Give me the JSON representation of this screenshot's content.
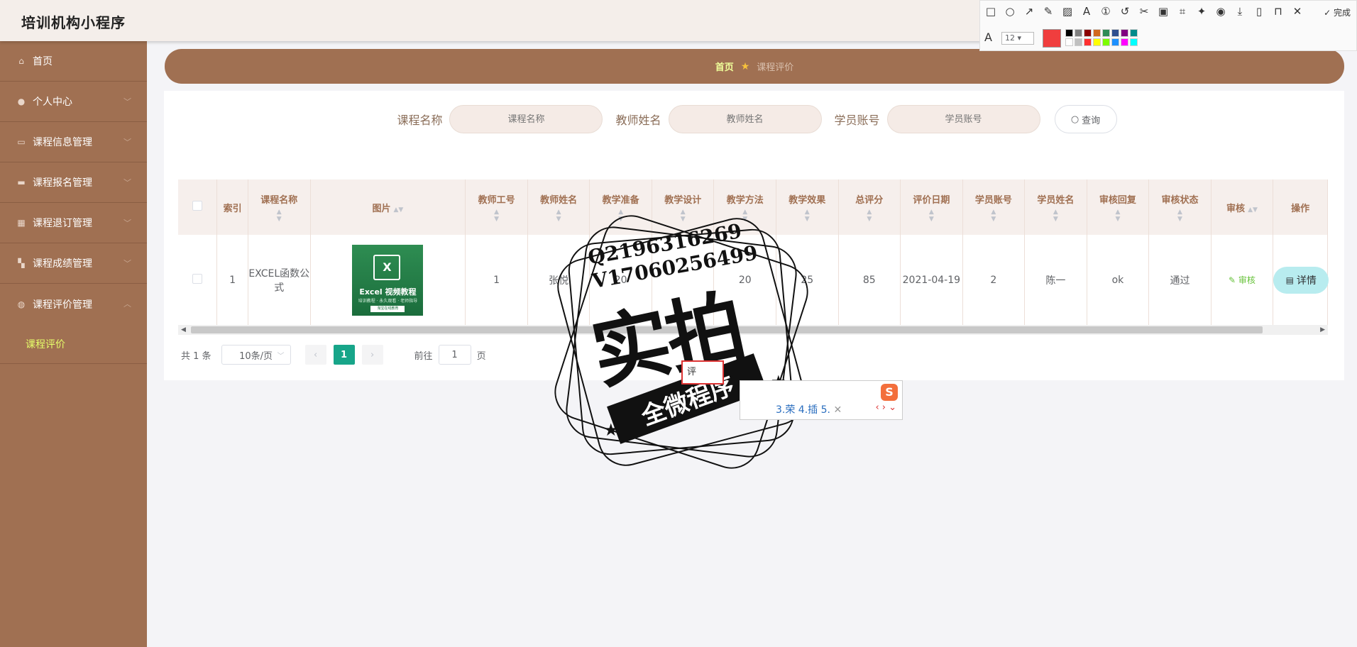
{
  "header": {
    "app_title": "培训机构小程序",
    "right_text": "…"
  },
  "sidebar": {
    "items": [
      {
        "label": "首页",
        "icon": "home-icon"
      },
      {
        "label": "个人中心",
        "icon": "user-icon"
      },
      {
        "label": "课程信息管理",
        "icon": "book-icon"
      },
      {
        "label": "课程报名管理",
        "icon": "form-icon"
      },
      {
        "label": "课程退订管理",
        "icon": "grid-icon"
      },
      {
        "label": "课程成绩管理",
        "icon": "apps-icon"
      },
      {
        "label": "课程评价管理",
        "icon": "circle-icon"
      }
    ],
    "submenu": [
      "课程评价"
    ]
  },
  "breadcrumb": {
    "home": "首页",
    "current": "课程评价"
  },
  "search": {
    "fields": [
      {
        "label": "课程名称",
        "placeholder": "课程名称"
      },
      {
        "label": "教师姓名",
        "placeholder": "教师姓名"
      },
      {
        "label": "学员账号",
        "placeholder": "学员账号"
      }
    ],
    "button": "查询"
  },
  "table": {
    "headers": [
      "索引",
      "课程名称",
      "图片",
      "教师工号",
      "教师姓名",
      "教学准备",
      "教学设计",
      "教学方法",
      "教学效果",
      "总评分",
      "评价日期",
      "学员账号",
      "学员姓名",
      "审核回复",
      "审核状态",
      "审核",
      "操作"
    ],
    "rows": [
      {
        "index": "1",
        "course_name": "EXCEL函数公式",
        "image_text": "Excel 视频教程",
        "image_sub": "培训教程 · 永久观看 · 老师指导",
        "image_tag": "淘宝在线教育",
        "teacher_id": "1",
        "teacher_name": "张悦",
        "prep": "20",
        "design": "",
        "method": "20",
        "effect": "25",
        "total": "85",
        "date": "2021-04-19",
        "student_account": "2",
        "student_name": "陈一",
        "reply": "ok",
        "status": "通过",
        "review_link": "审核",
        "action": "详情"
      }
    ]
  },
  "pagination": {
    "total": "共 1 条",
    "page_size": "10条/页",
    "current_page": "1",
    "goto_prefix": "前往",
    "goto_value": "1",
    "goto_suffix": "页"
  },
  "snip_toolbar": {
    "done": "完成",
    "font_size": "12",
    "current_color": "#f03e3e",
    "palette": [
      "#000000",
      "#808080",
      "#8b0000",
      "#d2691e",
      "#2e8b57",
      "#2f4f8f",
      "#800080",
      "#008b8b",
      "#ffffff",
      "#c0c0c0",
      "#ff3030",
      "#ffff00",
      "#7cfc00",
      "#1e90ff",
      "#ff00ff",
      "#00ffff"
    ]
  },
  "watermark": {
    "line1": "Q2196316269",
    "line2": "V17060256499",
    "big": "实拍",
    "ribbon": "全微程序"
  },
  "ime": {
    "composition": "评",
    "candidates": "3.荣 4.插 5.",
    "logo": "S"
  }
}
